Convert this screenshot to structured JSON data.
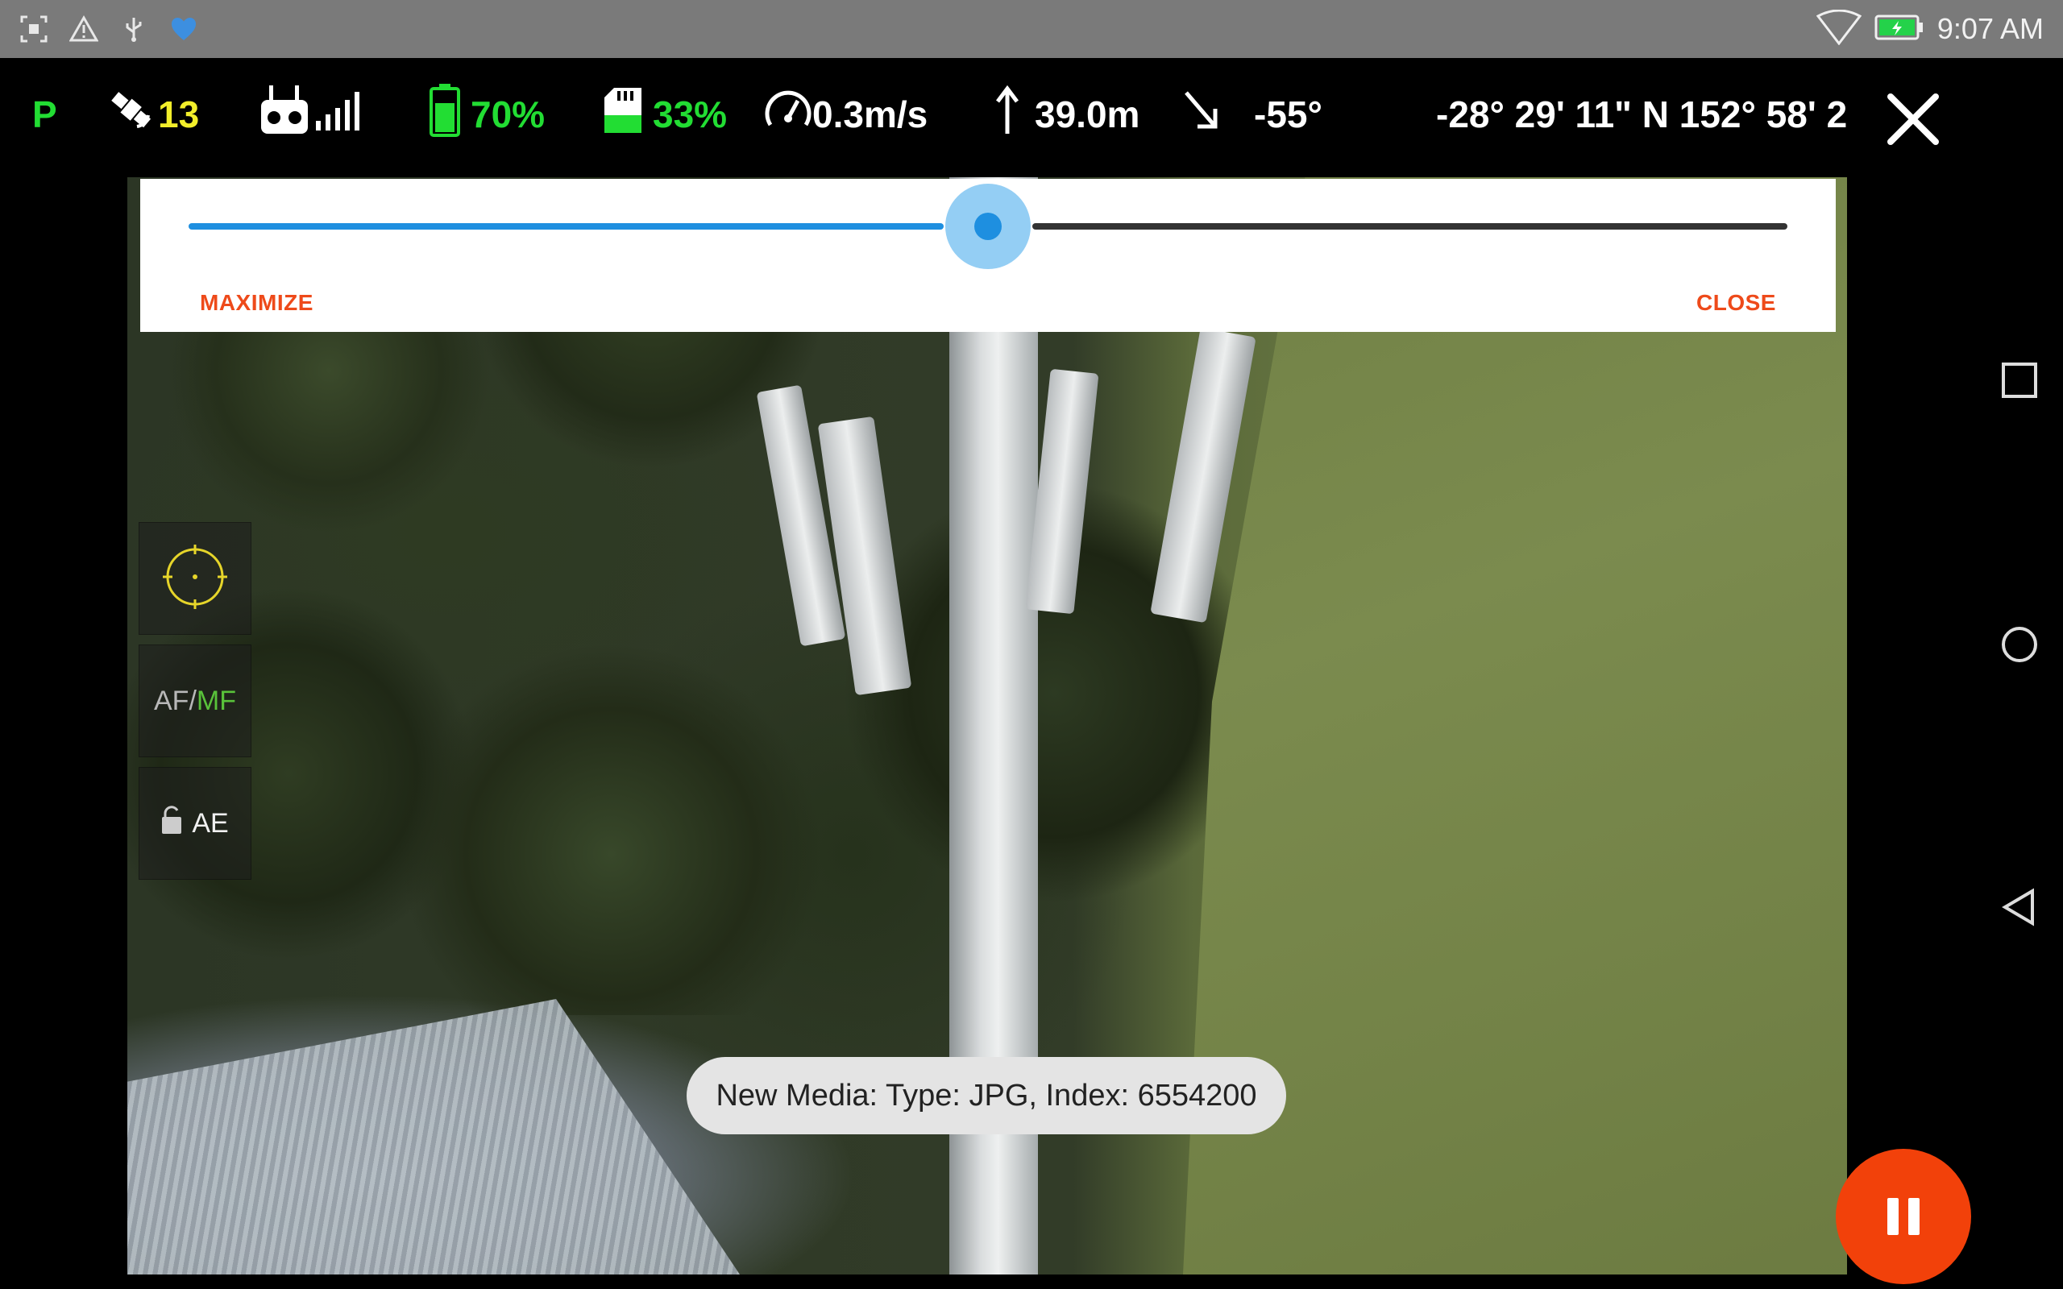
{
  "status_bar": {
    "clock": "9:07 AM",
    "icons": [
      "screenshot-icon",
      "warning-icon",
      "usb-icon",
      "heart-icon",
      "wifi-icon",
      "battery-charging-icon"
    ]
  },
  "telemetry": {
    "flight_mode": "P",
    "satellites": "13",
    "drone_battery": "70%",
    "sd_card": "33%",
    "speed": "0.3m/s",
    "altitude": "39.0m",
    "gimbal_pitch": "-55°",
    "coordinates": "-28° 29' 11\" N 152° 58' 2"
  },
  "slider_panel": {
    "maximize_label": "MAXIMIZE",
    "close_label": "CLOSE",
    "zoom_fraction": 0.5
  },
  "camera_controls": {
    "focus_af": "AF",
    "focus_sep": "/",
    "focus_mf": "MF",
    "exposure_label": "AE"
  },
  "toast": {
    "message": "New Media: Type: JPG, Index: 6554200"
  },
  "colors": {
    "accent_orange": "#f2410a",
    "slider_blue": "#1e8fe0",
    "telemetry_green": "#22dd33",
    "telemetry_yellow": "#f2ee2a"
  }
}
